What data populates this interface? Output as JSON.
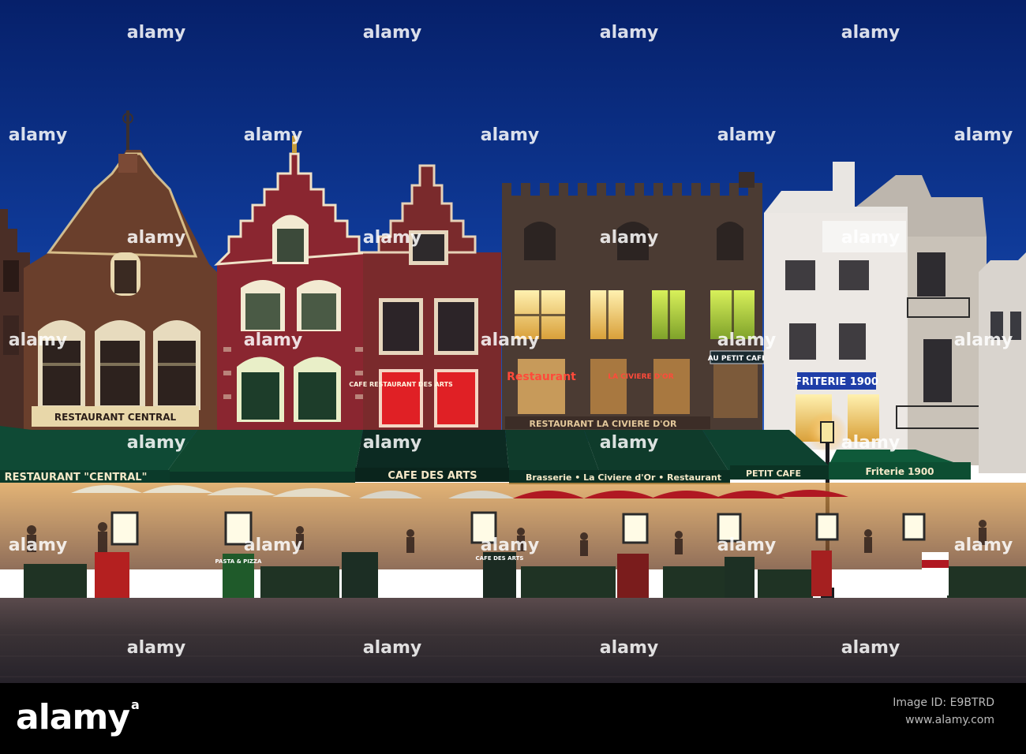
{
  "scene": {
    "signs": {
      "central_facade": "RESTAURANT CENTRAL",
      "restaurant_central_awning": "RESTAURANT \"CENTRAL\"",
      "cafe_neon": "CAFE RESTAURANT DES ARTS",
      "cafe_des_arts_awning": "CAFE DES ARTS",
      "restaurant_neon": "Restaurant",
      "la_civiere_neon": "LA CIVIERE D'OR",
      "la_civiere_facade": "RESTAURANT LA CIVIERE D'OR",
      "brasserie_awning": "Brasserie • La Civiere d'Or • Restaurant",
      "au_petit_cafe": "AU PETIT CAFE",
      "petit_cafe_awning": "PETIT CAFE",
      "friterie_lit": "FRITERIE 1900",
      "friterie_awning": "Friterie 1900",
      "pasta_board": "PASTA & PIZZA",
      "cafe_des_arts_board": "CAFE DES ARTS"
    },
    "watermark": "alamy",
    "colors": {
      "sky_top": "#0b2a78",
      "sky_bottom": "#1e4fb0",
      "awning_green": "#0f3b2b",
      "umbrella_red": "#b01822",
      "cobbles": "#3a3338",
      "neon_red": "#ff3b2f",
      "window_warm": "#f3d27a"
    }
  },
  "footer": {
    "logo": "alamy",
    "logo_mark": "a",
    "image_id_label": "Image ID: E9BTRD",
    "url": "www.alamy.com"
  }
}
